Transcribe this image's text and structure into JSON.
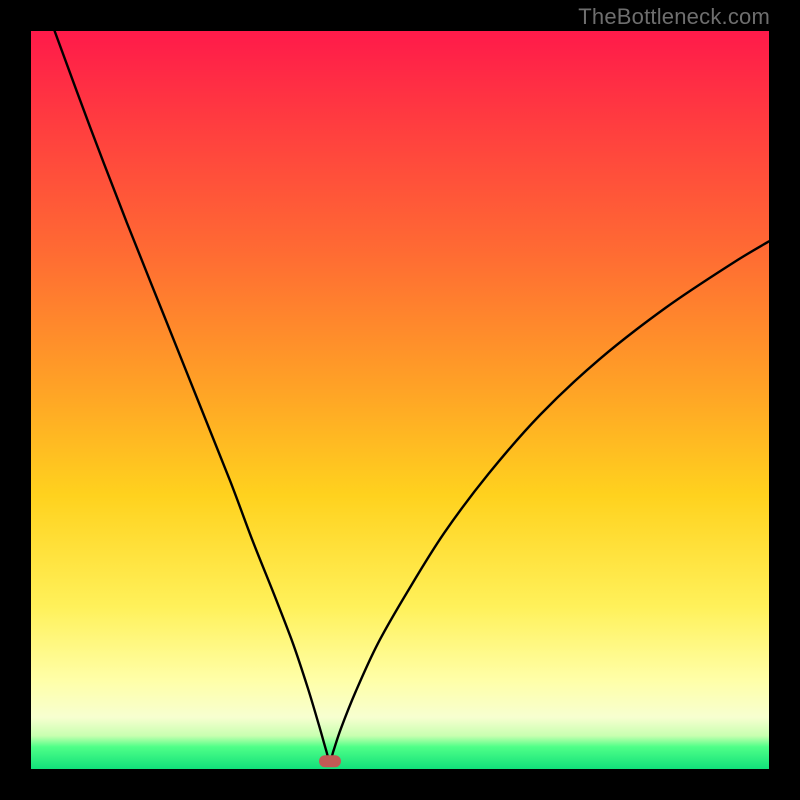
{
  "watermark": "TheBottleneck.com",
  "colors": {
    "frame": "#000000",
    "curve": "#000000",
    "marker": "#c25a55",
    "gradient_top": "#ff1a4a",
    "gradient_bottom": "#11e07a"
  },
  "chart_data": {
    "type": "line",
    "title": "",
    "xlabel": "",
    "ylabel": "",
    "xlim": [
      0,
      100
    ],
    "ylim": [
      0,
      100
    ],
    "grid": false,
    "legend": false,
    "annotations": [
      {
        "kind": "marker",
        "x": 40.5,
        "y": 1.2,
        "shape": "rounded-rect",
        "color": "#c25a55"
      }
    ],
    "series": [
      {
        "name": "bottleneck-curve",
        "color": "#000000",
        "x": [
          3.2,
          8,
          13,
          18,
          23,
          27,
          30,
          33,
          35.5,
          37.5,
          39,
          40,
          40.5,
          41,
          42,
          44,
          47,
          51,
          56,
          62,
          69,
          77,
          86,
          95,
          100
        ],
        "y": [
          100,
          87,
          74,
          61.5,
          49,
          39,
          31,
          23.5,
          17,
          11,
          6,
          2.5,
          1,
          2.5,
          5.5,
          10.5,
          17,
          24,
          32,
          40,
          48,
          55.5,
          62.5,
          68.5,
          71.5
        ]
      }
    ]
  }
}
